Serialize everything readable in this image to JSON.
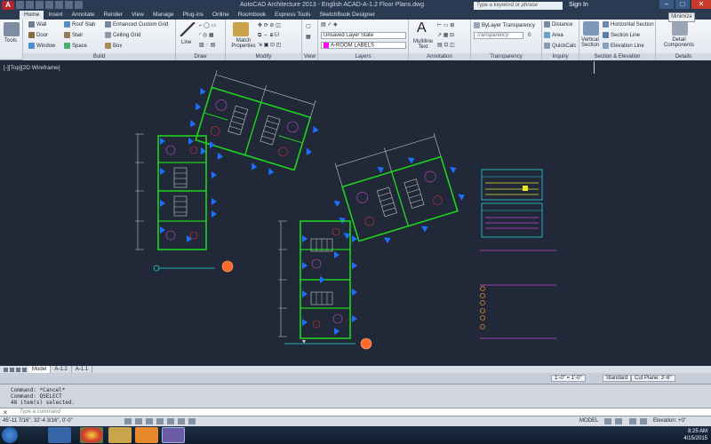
{
  "titlebar": {
    "title": "AutoCAD Architecture 2013 - English    ACAD-A-1.2 Floor Plans.dwg",
    "search_placeholder": "Type a keyword or phrase",
    "sign_in": "Sign In",
    "tooltip": "Minimize"
  },
  "ribbon_tabs": [
    "Home",
    "Insert",
    "Annotate",
    "Render",
    "View",
    "Manage",
    "Plug-ins",
    "Online",
    "Roombook",
    "Express Tools",
    "SketchBook Designer"
  ],
  "ribbon": {
    "tools": "Tools",
    "build": {
      "wall": "Wall",
      "door": "Door",
      "window": "Window",
      "roof_slab": "Roof Slab",
      "stair": "Stair",
      "space": "Space",
      "enhanced_grid": "Enhanced Custom Grid",
      "ceiling_grid": "Ceiling Grid",
      "box": "Box",
      "title": "Build"
    },
    "draw": {
      "line": "Line",
      "title": "Draw"
    },
    "modify": {
      "match": "Match Properties",
      "title": "Modify"
    },
    "view": {
      "title": "View"
    },
    "layers": {
      "state": "Unsaved Layer State",
      "current": "A-ROOM LABELS",
      "title": "Layers"
    },
    "annotation": {
      "mtext": "Multiline Text",
      "title": "Annotation"
    },
    "transparency": {
      "bylayer": "ByLayer Transparency",
      "label": "Transparency",
      "value": "0",
      "title": "Transparency"
    },
    "inquiry": {
      "distance": "Distance",
      "area": "Area",
      "quickcalc": "QuickCalc",
      "title": "Inquiry"
    },
    "section": {
      "vertical": "Vertical Section",
      "horizontal": "Horizontal Section",
      "line": "Section Line",
      "elevation": "Elevation Line",
      "title": "Section & Elevation"
    },
    "details": {
      "components": "Detail Components",
      "title": "Details"
    }
  },
  "viewport_label": "[-][Top][2D Wireframe]",
  "layout_tabs": [
    "Model",
    "A-1.2",
    "A-1.1"
  ],
  "annotation_strip": {
    "scale": "1'-0\" = 1'-0\"",
    "standard": "Standard",
    "cut_plane": "Cut Plane: 3'-6\""
  },
  "command_history": [
    "Command: *Cancel*",
    "Command: QSELECT",
    "48 item(s) selected."
  ],
  "command_prompt": "Type a command",
  "status": {
    "coords": "45'-11 7/16\", 32'-4 3/16\", 0'-0\"",
    "model": "MODEL",
    "elevation": "Elevation: +0\""
  },
  "clock": {
    "time": "8:25 AM",
    "date": "4/15/2015"
  },
  "colors": {
    "walls": "#1fd31f",
    "doors": "#1f6fff",
    "dims": "#c8c8c8",
    "annotation": "#c84ad0",
    "tags": "#ff6a2a",
    "bg": "#212838"
  }
}
